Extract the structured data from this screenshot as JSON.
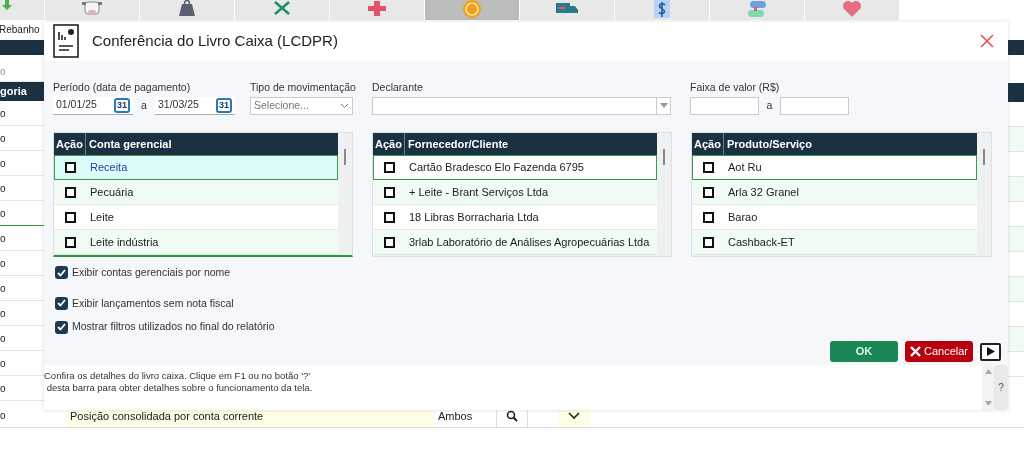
{
  "toolbar": {
    "first_label": "Rebanho",
    "tiles": [
      {
        "selected": false
      },
      {
        "selected": false
      },
      {
        "selected": false
      },
      {
        "selected": false
      },
      {
        "selected": true
      },
      {
        "selected": false
      },
      {
        "selected": false
      },
      {
        "selected": false
      },
      {
        "selected": false
      }
    ]
  },
  "background_table": {
    "column_1": "goria",
    "rows": [
      "o",
      "o",
      "o",
      "o",
      "o",
      "o",
      "o",
      "o",
      "o",
      "o",
      "o",
      "o",
      "o"
    ],
    "bottom_row": {
      "cells": [
        "o",
        "Posição consolidada por conta corrente",
        "Ambos"
      ]
    }
  },
  "dialog": {
    "title": "Conferência do Livro Caixa (LCDPR)",
    "period": {
      "label": "Período (data de pagamento)",
      "from": "01/01/25",
      "to": "31/03/25",
      "separator": "a",
      "calendars": [
        "31",
        "31"
      ]
    },
    "movement_type": {
      "label": "Tipo de movimentação",
      "placeholder": "Selecione..."
    },
    "declarant": {
      "label": "Declarante"
    },
    "value_range": {
      "label": "Faixa de valor (R$)",
      "separator": "a"
    },
    "tables": [
      {
        "active": true,
        "columns": [
          "Ação",
          "Conta gerencial"
        ],
        "rows": [
          {
            "label": "Receita",
            "checked": false,
            "selected": true
          },
          {
            "label": "Pecuária",
            "checked": false,
            "selected": false
          },
          {
            "label": "Leite",
            "checked": false,
            "selected": false
          },
          {
            "label": "Leite indústria",
            "checked": false,
            "selected": false
          }
        ]
      },
      {
        "active": false,
        "columns": [
          "Ação",
          "Fornecedor/Cliente"
        ],
        "rows": [
          {
            "label": "Cartão Bradesco Elo Fazenda 6795",
            "checked": false,
            "selected": true
          },
          {
            "label": "+ Leite - Brant Serviços Ltda",
            "checked": false,
            "selected": false
          },
          {
            "label": "18 Libras Borracharia Ltda",
            "checked": false,
            "selected": false
          },
          {
            "label": "3rlab Laboratório de Análises Agropecuárias Ltda",
            "checked": false,
            "selected": false
          }
        ]
      },
      {
        "active": false,
        "columns": [
          "Ação",
          "Produto/Serviço"
        ],
        "rows": [
          {
            "label": "Aot Ru",
            "checked": false,
            "selected": true
          },
          {
            "label": "Arla 32 Granel",
            "checked": false,
            "selected": false
          },
          {
            "label": "Barao",
            "checked": false,
            "selected": false
          },
          {
            "label": "Cashback-ET",
            "checked": false,
            "selected": false
          }
        ]
      }
    ],
    "options": [
      {
        "label": "Exibir contas gerenciais por nome",
        "checked": true
      },
      {
        "label": "Exibir lançamentos sem nota fiscal",
        "checked": true
      },
      {
        "label": "Mostrar filtros utilizados no final do relatório",
        "checked": true
      }
    ],
    "buttons": {
      "ok": "OK",
      "cancel": "Cancelar"
    },
    "help": {
      "lines": [
        "Confira os detalhes do livro caixa. Clique em F1 ou no botão '?'",
        " desta barra para obter detalhes sobre o funcionamento da tela."
      ],
      "button": "?"
    }
  }
}
